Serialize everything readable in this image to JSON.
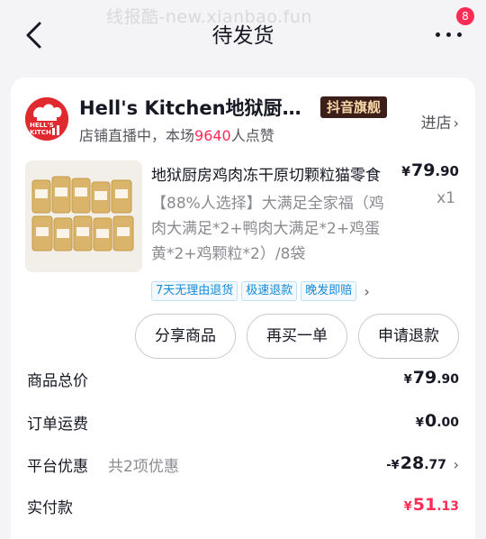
{
  "watermark": "线报酷-new.xianbao.fun",
  "header": {
    "title": "待发货",
    "notification_count": "8"
  },
  "shop": {
    "name": "Hell's Kitchen地狱厨房旗舰店",
    "badge": "抖音旗舰",
    "enter_label": "进店",
    "live_prefix": "店铺直播中，本场",
    "live_count": "9640",
    "live_suffix": "人点赞"
  },
  "product": {
    "title": "地狱厨房鸡肉冻干原切颗粒猫零食",
    "description": "【88%人选择】大满足全家福（鸡肉大满足*2+鸭肉大满足*2+鸡蛋黄*2+鸡颗粒*2）/8袋",
    "price_symbol": "¥",
    "price_int": "79",
    "price_dec": ".90",
    "quantity": "x1",
    "tags": [
      "7天无理由退货",
      "极速退款",
      "晚发即赔"
    ]
  },
  "actions": {
    "share": "分享商品",
    "rebuy": "再买一单",
    "refund": "申请退款"
  },
  "summary": {
    "total_label": "商品总价",
    "total_symbol": "¥",
    "total_int": "79",
    "total_dec": ".90",
    "shipping_label": "订单运费",
    "shipping_symbol": "¥",
    "shipping_int": "0",
    "shipping_dec": ".00",
    "discount_label": "平台优惠",
    "discount_sub": "共2项优惠",
    "discount_symbol": "-¥",
    "discount_int": "28",
    "discount_dec": ".77",
    "paid_label": "实付款",
    "paid_symbol": "¥",
    "paid_int": "51",
    "paid_dec": ".13"
  },
  "colors": {
    "accent": "#fe2c55",
    "brand_red": "#e02a2f",
    "tag_blue": "#168ad8"
  },
  "icons": [
    "back-arrow-icon",
    "more-dots-icon",
    "chevron-right-icon"
  ]
}
